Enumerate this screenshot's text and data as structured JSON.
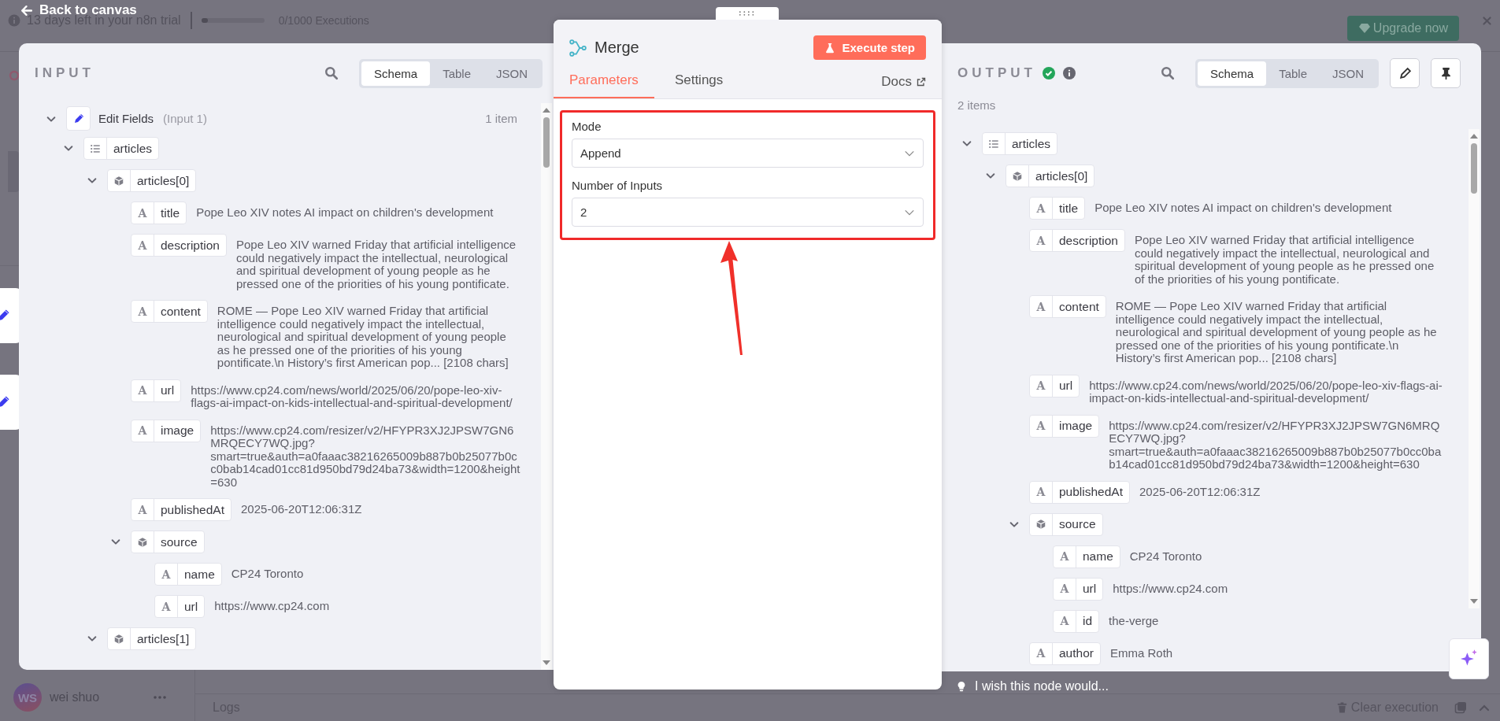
{
  "top_bar": {
    "back_label": "Back to canvas",
    "trial_text": "13 days left in your n8n trial",
    "executions": {
      "level": 0,
      "label": "0/1000 Executions"
    },
    "upgrade_label": "Upgrade now"
  },
  "sidebar": {
    "user": {
      "initials": "WS",
      "name": "wei shuo"
    }
  },
  "logs_bar": {
    "title": "Logs",
    "clear_label": "Clear execution"
  },
  "input_panel": {
    "title": "INPUT",
    "view_tabs": [
      {
        "label": "Schema",
        "selected": true
      },
      {
        "label": "Table",
        "selected": false
      },
      {
        "label": "JSON",
        "selected": false
      }
    ],
    "source": {
      "name": "Edit Fields",
      "note": "(Input 1)",
      "count": "1 item",
      "expanded": true
    },
    "tree": [
      {
        "kind": "array",
        "key": "articles",
        "expanded": true,
        "children": [
          {
            "kind": "object",
            "key": "articles[0]",
            "expanded": true,
            "children": [
              {
                "kind": "string",
                "type_label": "A",
                "key": "title",
                "value": "Pope Leo XIV notes AI impact on children's development"
              },
              {
                "kind": "string",
                "type_label": "A",
                "key": "description",
                "value": "Pope Leo XIV warned Friday that artificial intelligence could negatively impact the intellectual, neurological and spiritual development of young people as he pressed one of the priorities of his young pontificate."
              },
              {
                "kind": "string",
                "type_label": "A",
                "key": "content",
                "value": "ROME — Pope Leo XIV warned Friday that artificial intelligence could negatively impact the intellectual, neurological and spiritual development of young people as he pressed one of the priorities of his young pontificate.\\n History’s first American pop... [2108 chars]"
              },
              {
                "kind": "string",
                "type_label": "A",
                "key": "url",
                "value": "https://www.cp24.com/news/world/2025/06/20/pope-leo-xiv-flags-ai-impact-on-kids-intellectual-and-spiritual-development/"
              },
              {
                "kind": "string",
                "type_label": "A",
                "key": "image",
                "value": "https://www.cp24.com/resizer/v2/HFYPR3XJ2JPSW7GN6MRQECY7WQ.jpg?smart=true&auth=a0faaac38216265009b887b0b25077b0cc0bab14cad01cc81d950bd79d24ba73&width=1200&height=630"
              },
              {
                "kind": "string",
                "type_label": "A",
                "key": "publishedAt",
                "value": "2025-06-20T12:06:31Z"
              },
              {
                "kind": "object",
                "key": "source",
                "expanded": true,
                "children": [
                  {
                    "kind": "string",
                    "type_label": "A",
                    "key": "name",
                    "value": "CP24 Toronto"
                  },
                  {
                    "kind": "string",
                    "type_label": "A",
                    "key": "url",
                    "value": "https://www.cp24.com"
                  }
                ]
              }
            ]
          },
          {
            "kind": "object",
            "key": "articles[1]",
            "expanded": true
          }
        ]
      }
    ]
  },
  "node_panel": {
    "title": "Merge",
    "execute_label": "Execute step",
    "tabs": [
      {
        "label": "Parameters",
        "selected": true
      },
      {
        "label": "Settings",
        "selected": false
      }
    ],
    "docs_label": "Docs",
    "fields": [
      {
        "label": "Mode",
        "value": "Append"
      },
      {
        "label": "Number of Inputs",
        "value": "2"
      }
    ]
  },
  "output_panel": {
    "title": "OUTPUT",
    "success": true,
    "view_tabs": [
      {
        "label": "Schema",
        "selected": true
      },
      {
        "label": "Table",
        "selected": false
      },
      {
        "label": "JSON",
        "selected": false
      }
    ],
    "count": "2 items",
    "tree": [
      {
        "kind": "array",
        "key": "articles",
        "expanded": true,
        "children": [
          {
            "kind": "object",
            "key": "articles[0]",
            "expanded": true,
            "children": [
              {
                "kind": "string",
                "type_label": "A",
                "key": "title",
                "value": "Pope Leo XIV notes AI impact on children's development"
              },
              {
                "kind": "string",
                "type_label": "A",
                "key": "description",
                "value": "Pope Leo XIV warned Friday that artificial intelligence could negatively impact the intellectual, neurological and spiritual development of young people as he pressed one of the priorities of his young pontificate."
              },
              {
                "kind": "string",
                "type_label": "A",
                "key": "content",
                "value": "ROME — Pope Leo XIV warned Friday that artificial intelligence could negatively impact the intellectual, neurological and spiritual development of young people as he pressed one of the priorities of his young pontificate.\\n History’s first American pop... [2108 chars]"
              },
              {
                "kind": "string",
                "type_label": "A",
                "key": "url",
                "value": "https://www.cp24.com/news/world/2025/06/20/pope-leo-xiv-flags-ai-impact-on-kids-intellectual-and-spiritual-development/"
              },
              {
                "kind": "string",
                "type_label": "A",
                "key": "image",
                "value": "https://www.cp24.com/resizer/v2/HFYPR3XJ2JPSW7GN6MRQECY7WQ.jpg?smart=true&auth=a0faaac38216265009b887b0b25077b0cc0bab14cad01cc81d950bd79d24ba73&width=1200&height=630"
              },
              {
                "kind": "string",
                "type_label": "A",
                "key": "publishedAt",
                "value": "2025-06-20T12:06:31Z"
              },
              {
                "kind": "object",
                "key": "source",
                "expanded": true,
                "children": [
                  {
                    "kind": "string",
                    "type_label": "A",
                    "key": "name",
                    "value": "CP24 Toronto"
                  },
                  {
                    "kind": "string",
                    "type_label": "A",
                    "key": "url",
                    "value": "https://www.cp24.com"
                  },
                  {
                    "kind": "string",
                    "type_label": "A",
                    "key": "id",
                    "value": "the-verge"
                  }
                ]
              },
              {
                "kind": "string",
                "type_label": "A",
                "key": "author",
                "value": "Emma Roth"
              }
            ]
          }
        ]
      }
    ]
  },
  "feedback": {
    "label": "I wish this node would..."
  }
}
